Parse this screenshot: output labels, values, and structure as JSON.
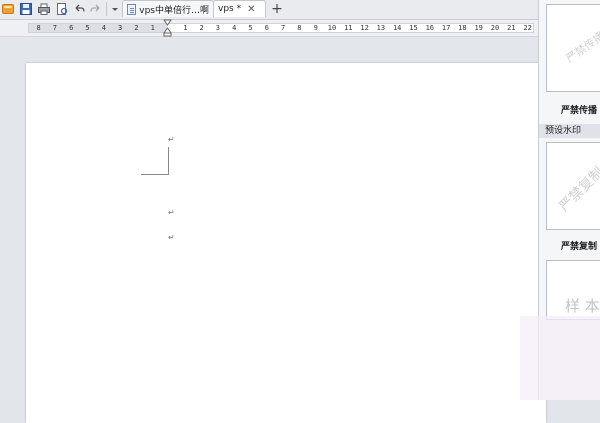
{
  "tabs": [
    {
      "label": "vps中单倍行…啊",
      "active": false
    },
    {
      "label": "vps *",
      "active": true
    }
  ],
  "icons": {
    "app": "wps-logo-icon",
    "save": "save-icon",
    "print": "print-icon",
    "print_preview": "print-preview-icon",
    "undo": "undo-icon",
    "redo": "redo-icon",
    "customize": "dropdown-arrow-icon",
    "document": "document-icon",
    "close": "close-icon",
    "new_tab": "plus-icon"
  },
  "ruler": {
    "left_ticks": [
      "8",
      "7",
      "6",
      "5",
      "4",
      "3",
      "2",
      "1"
    ],
    "right_ticks": [
      "1",
      "2",
      "3",
      "4",
      "5",
      "6",
      "7",
      "8",
      "9",
      "10",
      "11",
      "12",
      "13",
      "14",
      "15",
      "16",
      "17",
      "18",
      "19",
      "20",
      "21",
      "22"
    ]
  },
  "document": {
    "paragraph_mark": "↵"
  },
  "watermark_panel": {
    "items": [
      {
        "caption": "严禁传播",
        "preview_text": "严禁传播"
      },
      {
        "caption": "严禁复制",
        "preview_text": "严禁复制"
      },
      {
        "caption": "",
        "preview_text": "样 本"
      }
    ],
    "section_title": "预设水印"
  },
  "colors": {
    "chrome": "#e9ebef",
    "page": "#ffffff",
    "watermark_text": "#d2d2d2",
    "accent_blue": "#3a6bb5",
    "save_orange": "#f0a030"
  }
}
